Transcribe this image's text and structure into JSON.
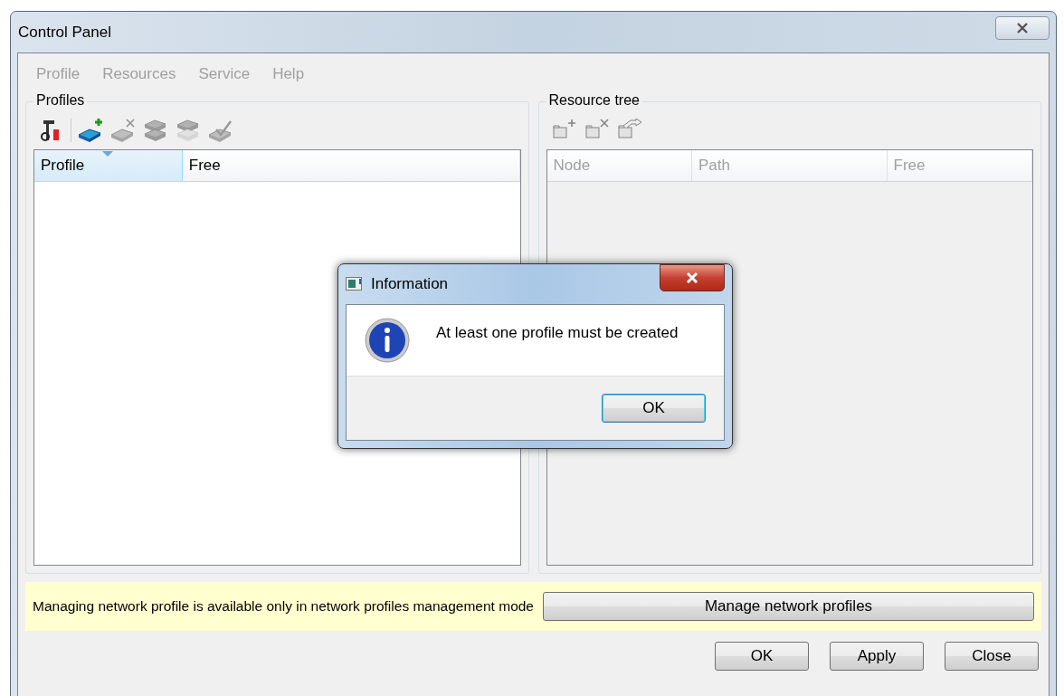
{
  "window": {
    "title": "Control Panel"
  },
  "menu": [
    {
      "label": "Profile",
      "disabled": true
    },
    {
      "label": "Resources",
      "disabled": true
    },
    {
      "label": "Service",
      "disabled": true
    },
    {
      "label": "Help",
      "disabled": true
    }
  ],
  "profiles": {
    "title": "Profiles",
    "toolbar": [
      {
        "kind": "tools",
        "disabled": false
      },
      {
        "kind": "separator"
      },
      {
        "kind": "add",
        "disabled": false
      },
      {
        "kind": "remove",
        "disabled": true
      },
      {
        "kind": "copy",
        "disabled": true
      },
      {
        "kind": "copy-light",
        "disabled": true
      },
      {
        "kind": "check",
        "disabled": true
      }
    ],
    "columns": [
      {
        "label": "Profile",
        "sorted": true,
        "disabled": false
      },
      {
        "label": "Free",
        "sorted": false,
        "disabled": false
      }
    ]
  },
  "resource_tree": {
    "title": "Resource tree",
    "toolbar": [
      {
        "kind": "folder-add",
        "disabled": true
      },
      {
        "kind": "folder-remove",
        "disabled": true
      },
      {
        "kind": "folder-move",
        "disabled": true
      }
    ],
    "columns": [
      {
        "label": "Node",
        "sorted": false,
        "disabled": true
      },
      {
        "label": "Path",
        "sorted": false,
        "disabled": true
      },
      {
        "label": "Free",
        "sorted": false,
        "disabled": true
      }
    ]
  },
  "notice": {
    "text": "Managing network profile is available only in network profiles management mode",
    "button": "Manage network profiles"
  },
  "buttons": [
    "OK",
    "Apply",
    "Close"
  ],
  "dialog": {
    "title": "Information",
    "message": "At least one profile must be created",
    "button": "OK"
  }
}
